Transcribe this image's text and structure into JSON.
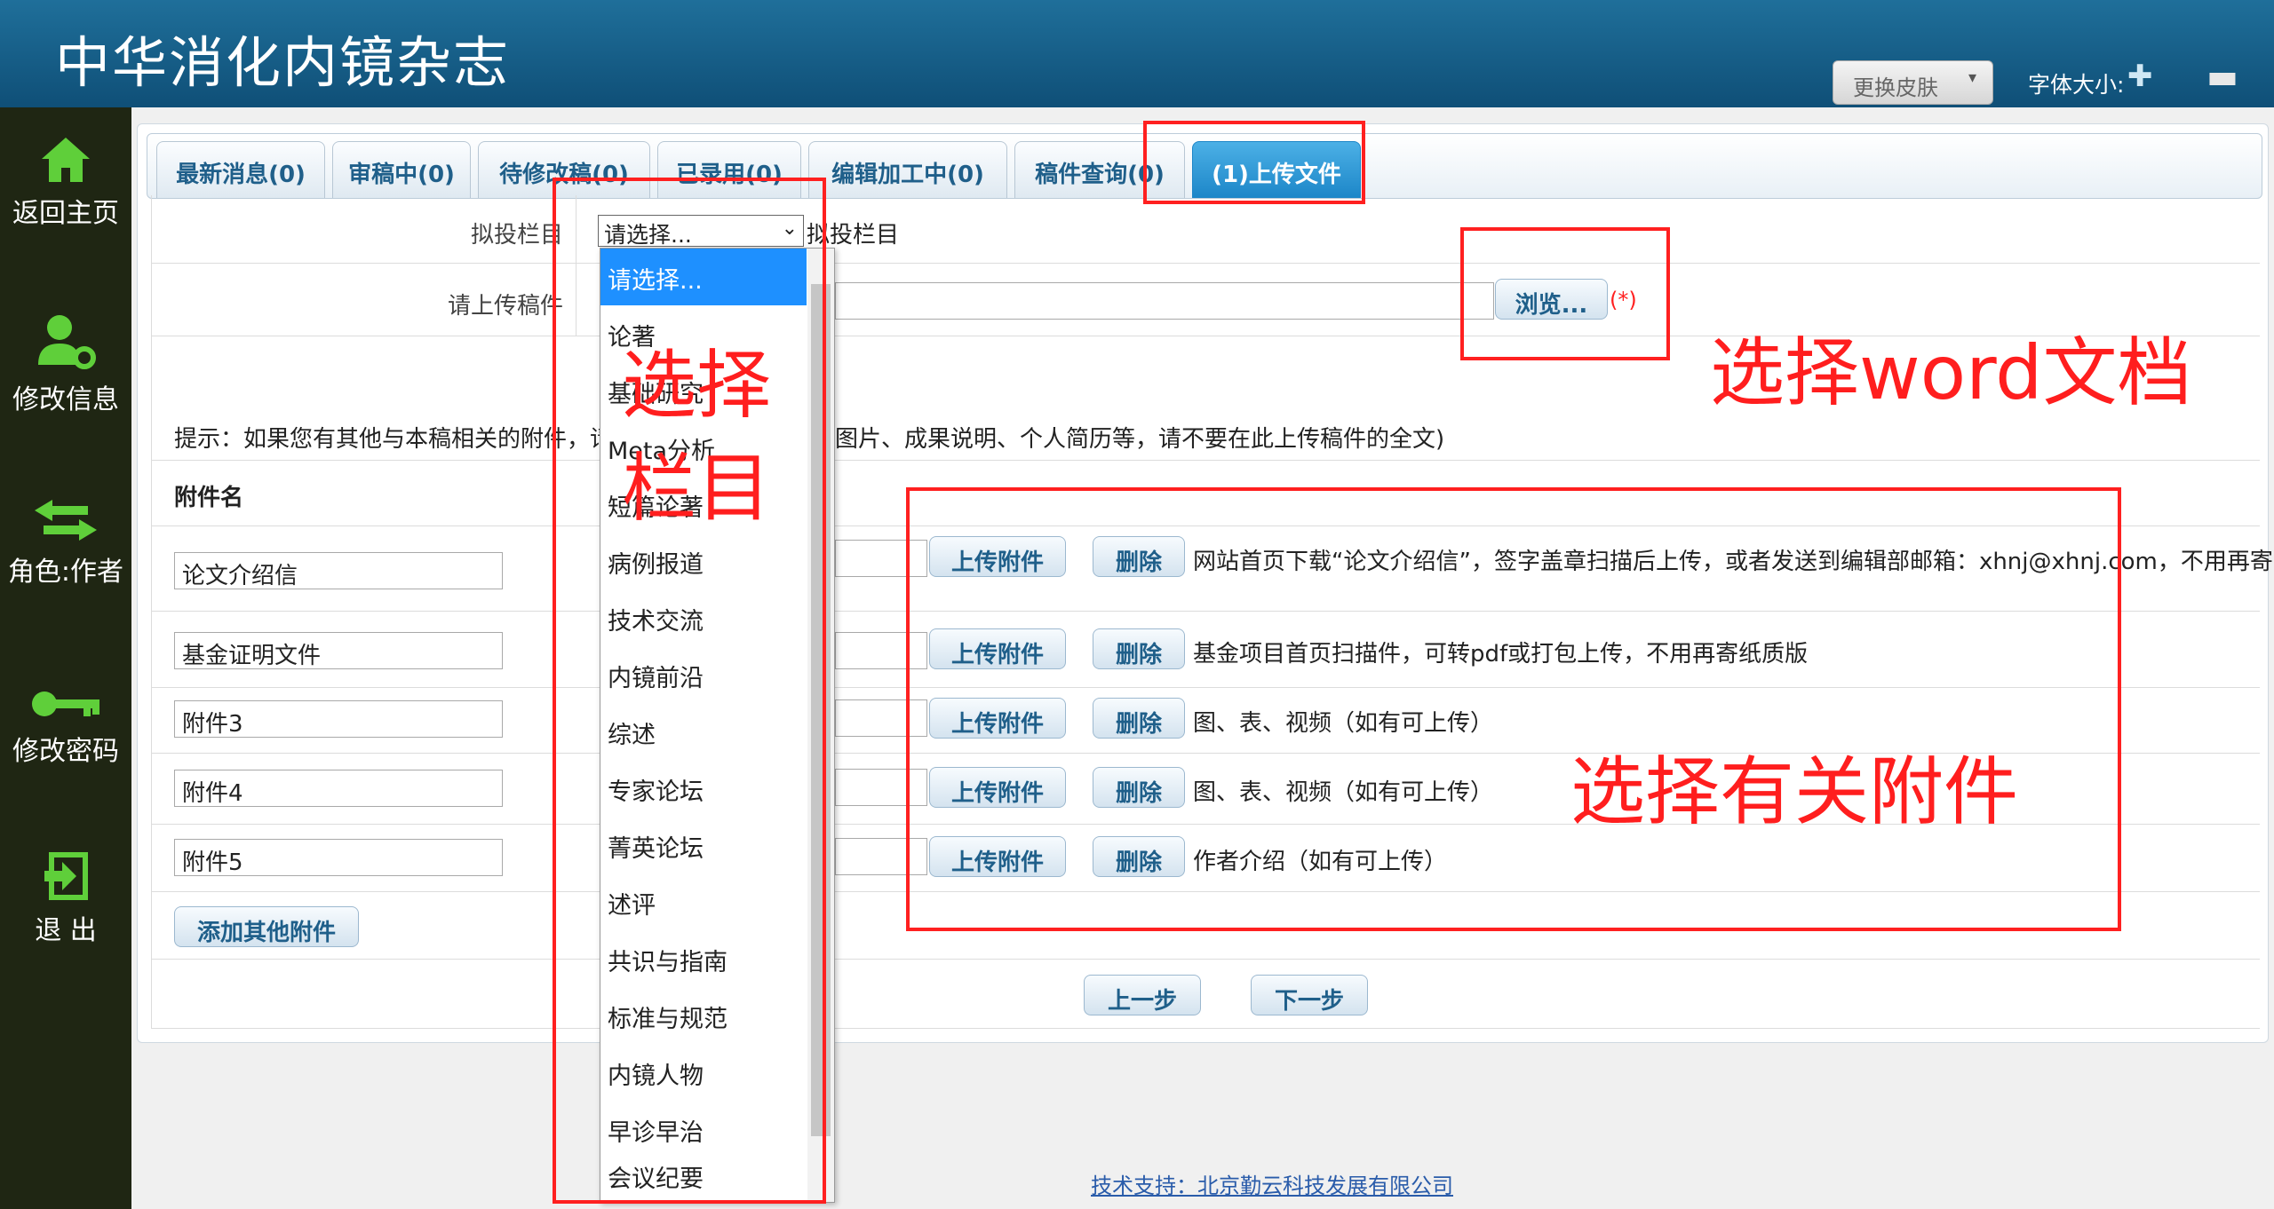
{
  "header": {
    "title": "中华消化内镜杂志",
    "skin_label": "更换皮肤",
    "font_size_label": "字体大小:",
    "font_plus": "✚",
    "font_minus": "▬"
  },
  "sidebar": {
    "items": [
      {
        "label": "返回主页",
        "icon": "home-icon"
      },
      {
        "label": "修改信息",
        "icon": "user-settings-icon"
      },
      {
        "label": "角色:作者",
        "icon": "swap-arrows-icon"
      },
      {
        "label": "修改密码",
        "icon": "key-icon"
      },
      {
        "label": "退 出",
        "icon": "logout-icon"
      }
    ]
  },
  "tabs": [
    {
      "label": "最新消息(0)"
    },
    {
      "label": "审稿中(0)"
    },
    {
      "label": "待修改稿(0)"
    },
    {
      "label": "已录用(0)"
    },
    {
      "label": "编辑加工中(0)"
    },
    {
      "label": "稿件查询(0)"
    },
    {
      "label": "(1)上传文件",
      "active": true
    }
  ],
  "form": {
    "column_label": "拟投栏目",
    "column_select_value": "请选择...",
    "column_label_repeat": "拟投栏目",
    "upload_label": "请上传稿件",
    "browse_button": "浏览...",
    "required_mark": "(*)",
    "hint_left": "提示：如果您有其他与本稿相关的附件，请",
    "hint_right": "图片、成果说明、个人简历等，请不要在此上传稿件的全文)",
    "attachment_header": "附件名",
    "attachments": [
      {
        "name": "论文介绍信",
        "upload": "上传附件",
        "delete": "删除",
        "note": "网站首页下载“论文介绍信”，签字盖章扫描后上传，或者发送到编辑部邮箱：xhnj@xhnj.com，不用再寄纸"
      },
      {
        "name": "基金证明文件",
        "upload": "上传附件",
        "delete": "删除",
        "note": "基金项目首页扫描件，可转pdf或打包上传，不用再寄纸质版"
      },
      {
        "name": "附件3",
        "upload": "上传附件",
        "delete": "删除",
        "note": "图、表、视频（如有可上传）"
      },
      {
        "name": "附件4",
        "upload": "上传附件",
        "delete": "删除",
        "note": "图、表、视频（如有可上传）"
      },
      {
        "name": "附件5",
        "upload": "上传附件",
        "delete": "删除",
        "note": "作者介绍（如有可上传）"
      }
    ],
    "add_other_button": "添加其他附件",
    "prev_button": "上一步",
    "next_button": "下一步"
  },
  "dropdown": {
    "options": [
      "请选择...",
      "论著",
      "基础研究",
      "Meta分析",
      "短篇论著",
      "病例报道",
      "技术交流",
      "内镜前沿",
      "综述",
      "专家论坛",
      "菁英论坛",
      "述评",
      "共识与指南",
      "标准与规范",
      "内镜人物",
      "早诊早治",
      "会议纪要"
    ]
  },
  "annotations": {
    "select_column_line1": "选择",
    "select_column_line2": "栏目",
    "select_word": "选择word文档",
    "select_attachments": "选择有关附件"
  },
  "footer": {
    "support": "技术支持：北京勤云科技发展有限公司"
  },
  "colors": {
    "header": "#1a6590",
    "sidebar": "#1f2613",
    "accent": "#1e90ff",
    "annotation": "#ff1e1e"
  }
}
